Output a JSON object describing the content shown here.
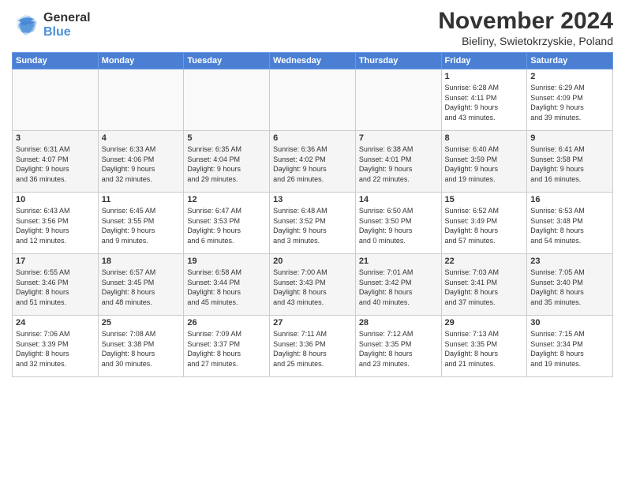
{
  "logo": {
    "general": "General",
    "blue": "Blue"
  },
  "title": "November 2024",
  "location": "Bieliny, Swietokrzyskie, Poland",
  "weekdays": [
    "Sunday",
    "Monday",
    "Tuesday",
    "Wednesday",
    "Thursday",
    "Friday",
    "Saturday"
  ],
  "weeks": [
    [
      {
        "day": "",
        "info": ""
      },
      {
        "day": "",
        "info": ""
      },
      {
        "day": "",
        "info": ""
      },
      {
        "day": "",
        "info": ""
      },
      {
        "day": "",
        "info": ""
      },
      {
        "day": "1",
        "info": "Sunrise: 6:28 AM\nSunset: 4:11 PM\nDaylight: 9 hours\nand 43 minutes."
      },
      {
        "day": "2",
        "info": "Sunrise: 6:29 AM\nSunset: 4:09 PM\nDaylight: 9 hours\nand 39 minutes."
      }
    ],
    [
      {
        "day": "3",
        "info": "Sunrise: 6:31 AM\nSunset: 4:07 PM\nDaylight: 9 hours\nand 36 minutes."
      },
      {
        "day": "4",
        "info": "Sunrise: 6:33 AM\nSunset: 4:06 PM\nDaylight: 9 hours\nand 32 minutes."
      },
      {
        "day": "5",
        "info": "Sunrise: 6:35 AM\nSunset: 4:04 PM\nDaylight: 9 hours\nand 29 minutes."
      },
      {
        "day": "6",
        "info": "Sunrise: 6:36 AM\nSunset: 4:02 PM\nDaylight: 9 hours\nand 26 minutes."
      },
      {
        "day": "7",
        "info": "Sunrise: 6:38 AM\nSunset: 4:01 PM\nDaylight: 9 hours\nand 22 minutes."
      },
      {
        "day": "8",
        "info": "Sunrise: 6:40 AM\nSunset: 3:59 PM\nDaylight: 9 hours\nand 19 minutes."
      },
      {
        "day": "9",
        "info": "Sunrise: 6:41 AM\nSunset: 3:58 PM\nDaylight: 9 hours\nand 16 minutes."
      }
    ],
    [
      {
        "day": "10",
        "info": "Sunrise: 6:43 AM\nSunset: 3:56 PM\nDaylight: 9 hours\nand 12 minutes."
      },
      {
        "day": "11",
        "info": "Sunrise: 6:45 AM\nSunset: 3:55 PM\nDaylight: 9 hours\nand 9 minutes."
      },
      {
        "day": "12",
        "info": "Sunrise: 6:47 AM\nSunset: 3:53 PM\nDaylight: 9 hours\nand 6 minutes."
      },
      {
        "day": "13",
        "info": "Sunrise: 6:48 AM\nSunset: 3:52 PM\nDaylight: 9 hours\nand 3 minutes."
      },
      {
        "day": "14",
        "info": "Sunrise: 6:50 AM\nSunset: 3:50 PM\nDaylight: 9 hours\nand 0 minutes."
      },
      {
        "day": "15",
        "info": "Sunrise: 6:52 AM\nSunset: 3:49 PM\nDaylight: 8 hours\nand 57 minutes."
      },
      {
        "day": "16",
        "info": "Sunrise: 6:53 AM\nSunset: 3:48 PM\nDaylight: 8 hours\nand 54 minutes."
      }
    ],
    [
      {
        "day": "17",
        "info": "Sunrise: 6:55 AM\nSunset: 3:46 PM\nDaylight: 8 hours\nand 51 minutes."
      },
      {
        "day": "18",
        "info": "Sunrise: 6:57 AM\nSunset: 3:45 PM\nDaylight: 8 hours\nand 48 minutes."
      },
      {
        "day": "19",
        "info": "Sunrise: 6:58 AM\nSunset: 3:44 PM\nDaylight: 8 hours\nand 45 minutes."
      },
      {
        "day": "20",
        "info": "Sunrise: 7:00 AM\nSunset: 3:43 PM\nDaylight: 8 hours\nand 43 minutes."
      },
      {
        "day": "21",
        "info": "Sunrise: 7:01 AM\nSunset: 3:42 PM\nDaylight: 8 hours\nand 40 minutes."
      },
      {
        "day": "22",
        "info": "Sunrise: 7:03 AM\nSunset: 3:41 PM\nDaylight: 8 hours\nand 37 minutes."
      },
      {
        "day": "23",
        "info": "Sunrise: 7:05 AM\nSunset: 3:40 PM\nDaylight: 8 hours\nand 35 minutes."
      }
    ],
    [
      {
        "day": "24",
        "info": "Sunrise: 7:06 AM\nSunset: 3:39 PM\nDaylight: 8 hours\nand 32 minutes."
      },
      {
        "day": "25",
        "info": "Sunrise: 7:08 AM\nSunset: 3:38 PM\nDaylight: 8 hours\nand 30 minutes."
      },
      {
        "day": "26",
        "info": "Sunrise: 7:09 AM\nSunset: 3:37 PM\nDaylight: 8 hours\nand 27 minutes."
      },
      {
        "day": "27",
        "info": "Sunrise: 7:11 AM\nSunset: 3:36 PM\nDaylight: 8 hours\nand 25 minutes."
      },
      {
        "day": "28",
        "info": "Sunrise: 7:12 AM\nSunset: 3:35 PM\nDaylight: 8 hours\nand 23 minutes."
      },
      {
        "day": "29",
        "info": "Sunrise: 7:13 AM\nSunset: 3:35 PM\nDaylight: 8 hours\nand 21 minutes."
      },
      {
        "day": "30",
        "info": "Sunrise: 7:15 AM\nSunset: 3:34 PM\nDaylight: 8 hours\nand 19 minutes."
      }
    ]
  ]
}
